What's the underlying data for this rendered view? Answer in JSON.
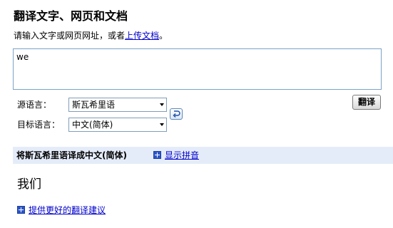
{
  "page": {
    "title": "翻译文字、网页和文档",
    "instruction_text": "请输入文字或网页网址，或者",
    "upload_link": "上传文档",
    "instruction_end": "。"
  },
  "input": {
    "value": "we",
    "placeholder": ""
  },
  "source_lang": {
    "label": "源语言：",
    "selected": "斯瓦希里语"
  },
  "target_lang": {
    "label": "目标语言：",
    "selected": "中文(简体)"
  },
  "icons": {
    "swap": "swap-languages-icon",
    "expand": "plus-icon",
    "dropdown": "chevron-down-icon"
  },
  "translate_button": {
    "label": "翻译"
  },
  "result": {
    "header": "将斯瓦希里语译成中文(简体)",
    "show_pinyin": "显示拼音",
    "translation": "我们",
    "suggest_link": "提供更好的翻译建议"
  },
  "colors": {
    "link": "#0000cc",
    "result_bar": "#e5ecf9",
    "textarea_border": "#7aa2c7",
    "plus_icon": "#2a55c8"
  }
}
